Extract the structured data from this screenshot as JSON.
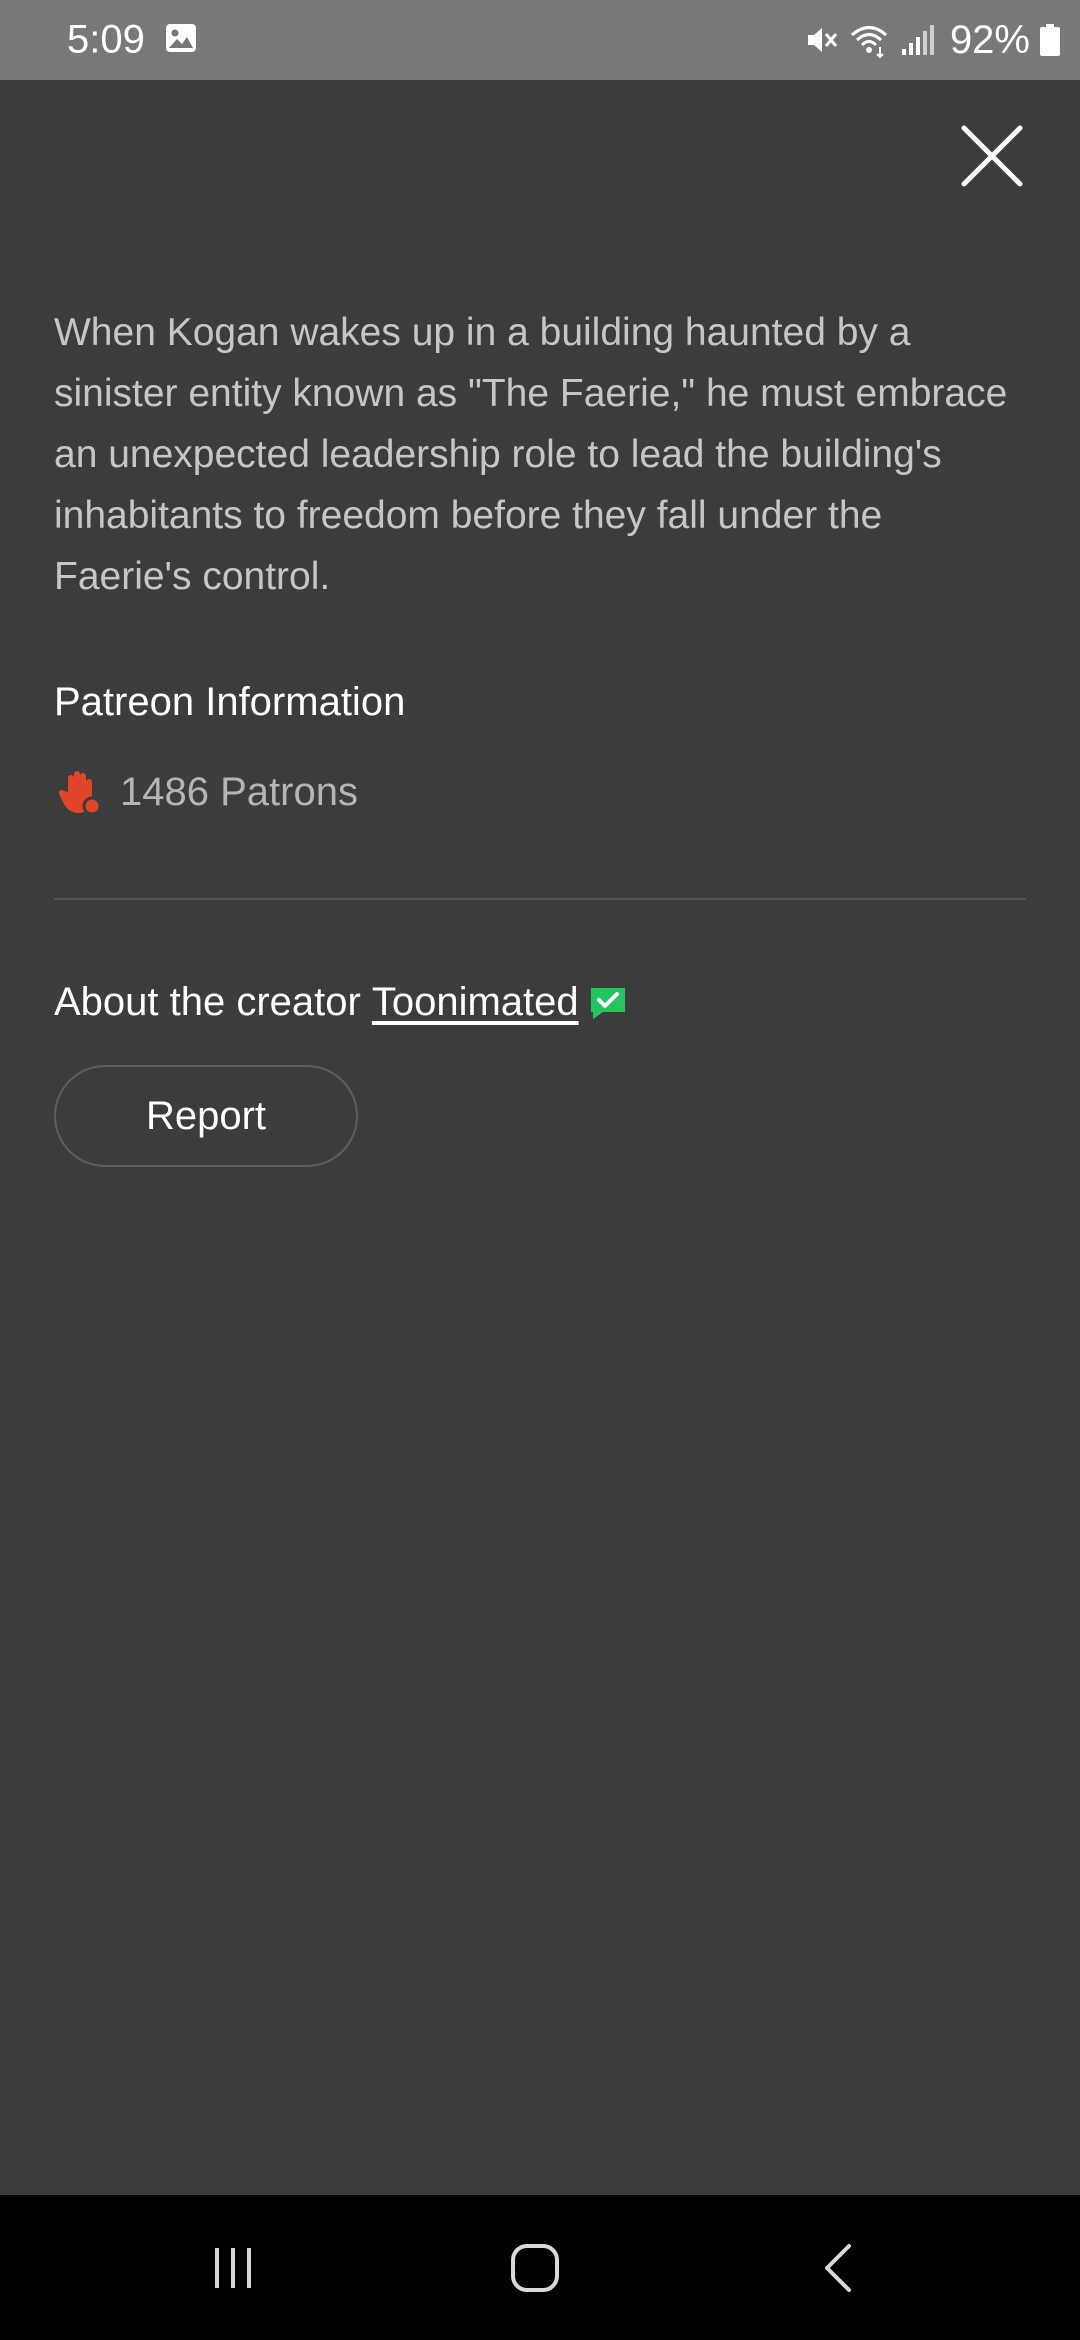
{
  "status_bar": {
    "time": "5:09",
    "battery": "92%",
    "icons": [
      "gallery-icon",
      "mute-icon",
      "wifi-icon",
      "signal-icon",
      "battery-icon"
    ]
  },
  "close_icon": "close-icon",
  "description": "When Kogan wakes up in a building haunted by a sinister entity known as \"The Faerie,\" he must embrace an unexpected leadership role to lead the building's inhabitants to freedom before they fall under the Faerie's control.",
  "patreon": {
    "heading": "Patreon Information",
    "icon": "patreon-hand-icon",
    "patrons": "1486 Patrons"
  },
  "creator": {
    "prefix": "About the creator",
    "name": "Toonimated",
    "verified_icon": "verified-badge-icon"
  },
  "report_button": "Report",
  "colors": {
    "background": "#3c3c3c",
    "status_bar": "#787878",
    "accent_red": "#e0452b",
    "verified_green": "#22c55e"
  },
  "nav_bar": {
    "icons": [
      "recents-icon",
      "home-icon",
      "back-icon"
    ]
  }
}
